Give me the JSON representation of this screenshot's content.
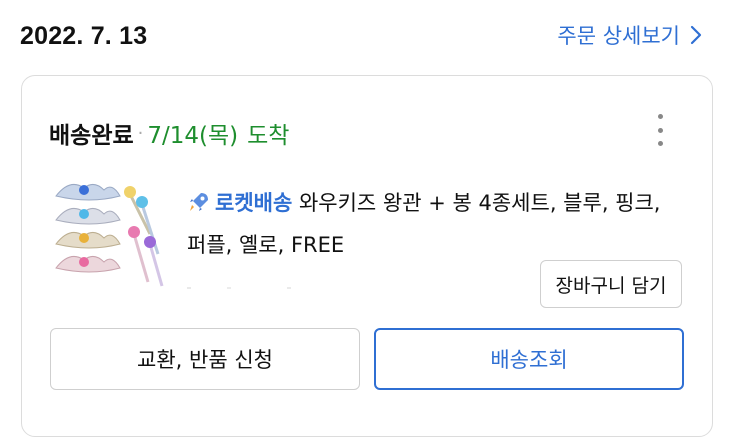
{
  "order": {
    "date": "2022. 7. 13",
    "detail_link_label": "주문 상세보기"
  },
  "delivery": {
    "status": "배송완료",
    "separator": "·",
    "arrival_date": "7/14(목)",
    "arrival_label": "도착"
  },
  "product": {
    "badge": "로켓배송",
    "name_line1": "와우키즈 왕관 + 봉 4종세트, 블루, 핑크,",
    "name_line2": "퍼플, 옐로, FREE"
  },
  "buttons": {
    "cart": "장바구니 담기",
    "exchange": "교환, 반품 신청",
    "track": "배송조회"
  },
  "icons": {
    "chevron": "chevron-right-icon",
    "menu": "more-vertical-icon",
    "rocket": "rocket-icon",
    "thumbnail": "product-thumbnail"
  },
  "colors": {
    "accent_blue": "#2f6fd3",
    "arrival_green": "#1e8e2e"
  }
}
